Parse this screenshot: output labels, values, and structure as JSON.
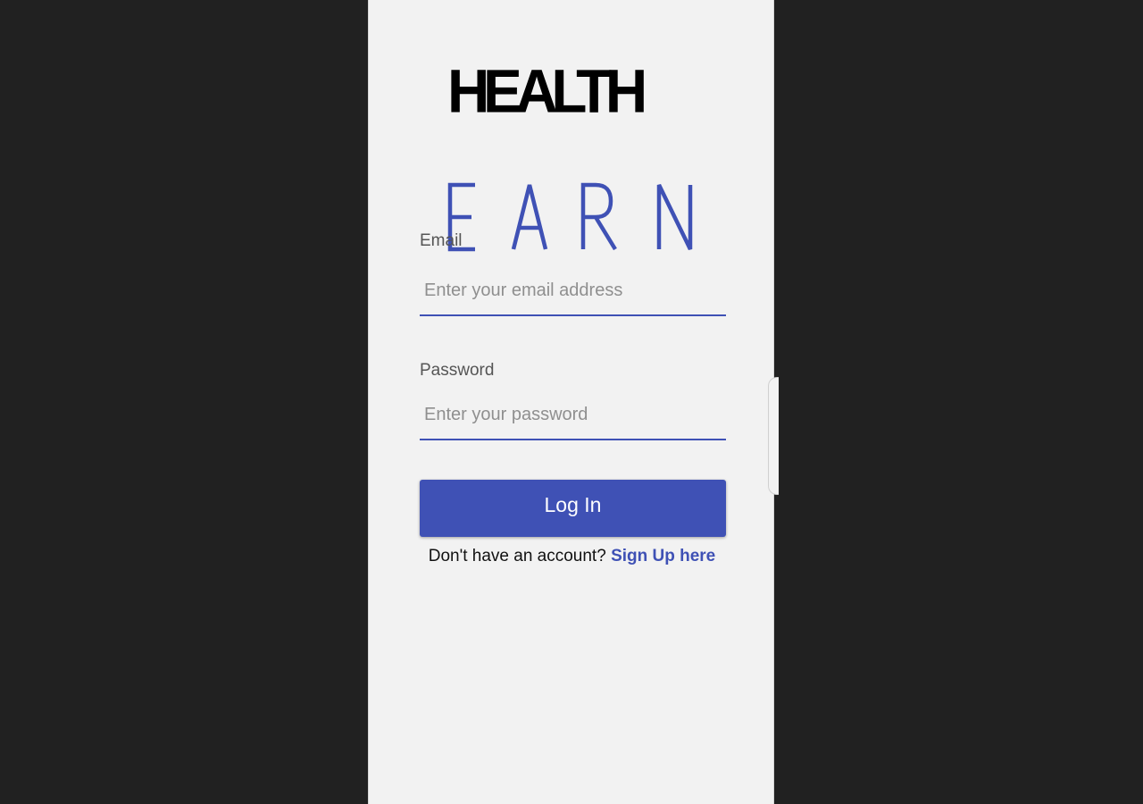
{
  "logo": {
    "line1": "HEALTH",
    "line2": "EARN",
    "line1_color": "#000000",
    "line2_color": "#3f51b5"
  },
  "form": {
    "email": {
      "label": "Email",
      "placeholder": "Enter your email address",
      "value": ""
    },
    "password": {
      "label": "Password",
      "placeholder": "Enter your password",
      "value": ""
    },
    "login_label": "Log In"
  },
  "signup": {
    "prompt": "Don't have an account?",
    "link_label": "Sign Up here"
  },
  "colors": {
    "accent": "#3f51b5",
    "background": "#f2f2f2",
    "outer": "#212121"
  }
}
